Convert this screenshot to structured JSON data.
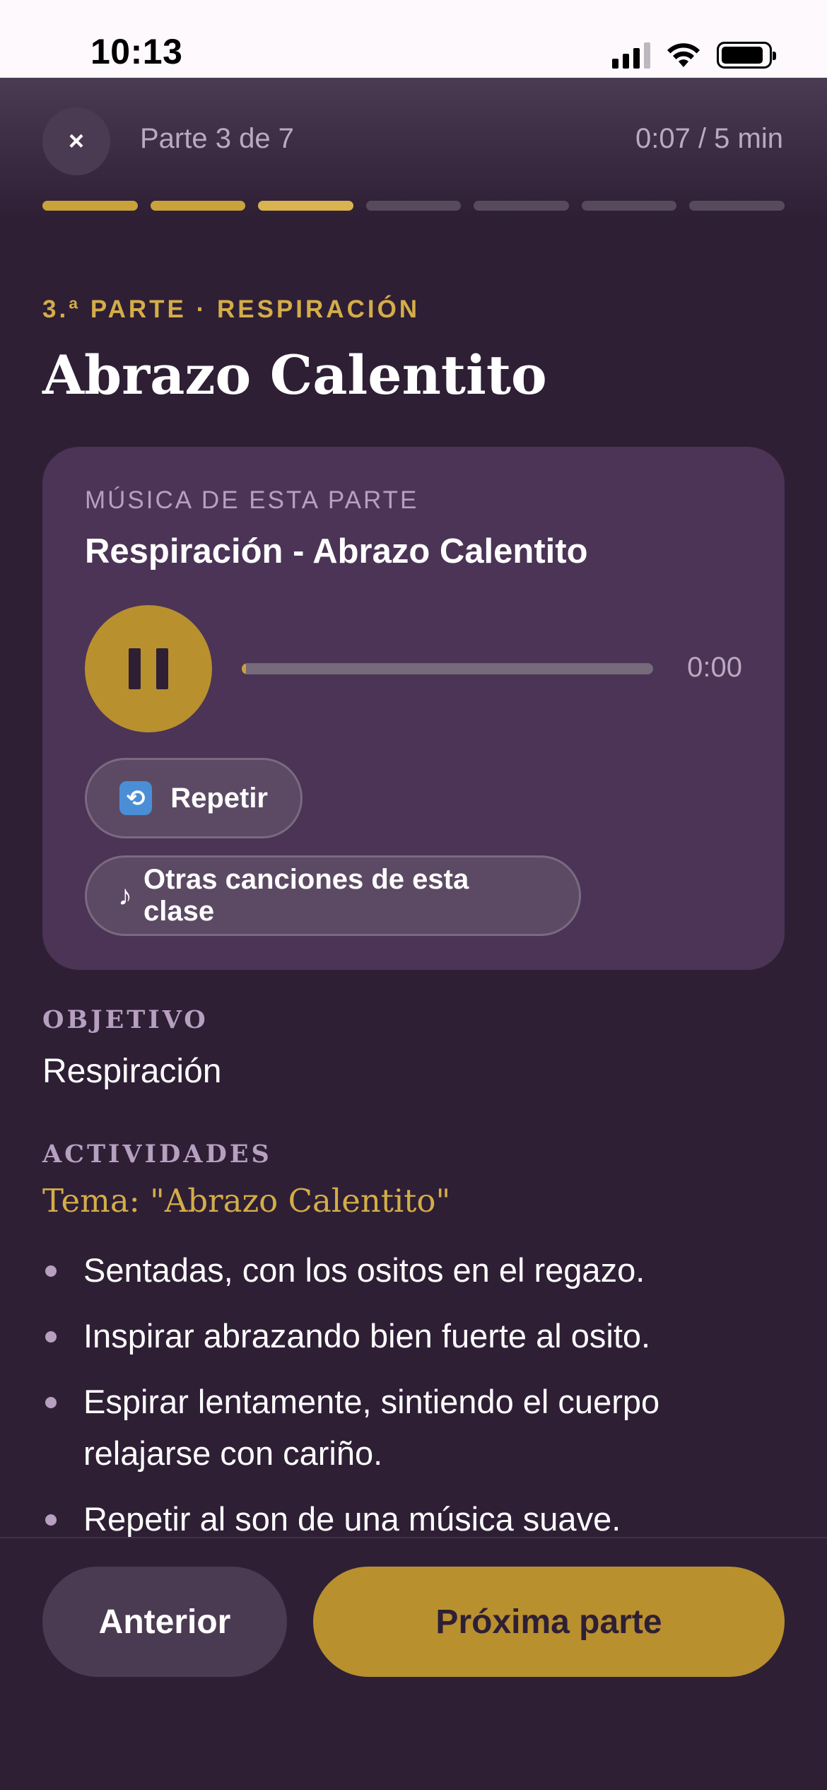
{
  "status_bar": {
    "time": "10:13",
    "icons": [
      "signal-icon",
      "wifi-icon",
      "battery-icon"
    ]
  },
  "header": {
    "close_glyph": "×",
    "part_label": "Parte 3 de 7",
    "time_label": "0:07 / 5 min",
    "progress": {
      "total_parts": 7,
      "completed_parts": 2,
      "current_part": 3
    }
  },
  "section": {
    "kicker": "3.ª PARTE · RESPIRACIÓN",
    "title": "Abrazo Calentito"
  },
  "music_card": {
    "kicker": "MÚSICA DE ESTA PARTE",
    "track_title": "Respiración - Abrazo Calentito",
    "player_state": "playing",
    "track_time": "0:00",
    "track_progress": 0.01,
    "repeat_label": "Repetir",
    "repeat_icon_glyph": "⟲",
    "others_label": "Otras canciones de esta clase",
    "note_glyph": "♪"
  },
  "objetivo": {
    "label": "OBJETIVO",
    "value": "Respiración"
  },
  "actividades": {
    "label": "ACTIVIDADES",
    "tema": "Tema: \"Abrazo Calentito\"",
    "items": [
      "Sentadas, con los ositos en el regazo.",
      "Inspirar abrazando bien fuerte al osito.",
      "Espirar lentamente, sintiendo el cuerpo relajarse con cariño.",
      "Repetir al son de una música suave."
    ]
  },
  "footer": {
    "prev_label": "Anterior",
    "next_label": "Próxima parte"
  },
  "colors": {
    "background": "#2e1f35",
    "accent_gold": "#b9902e",
    "card": "#4b3456",
    "muted_lilac": "#b79fc0"
  }
}
